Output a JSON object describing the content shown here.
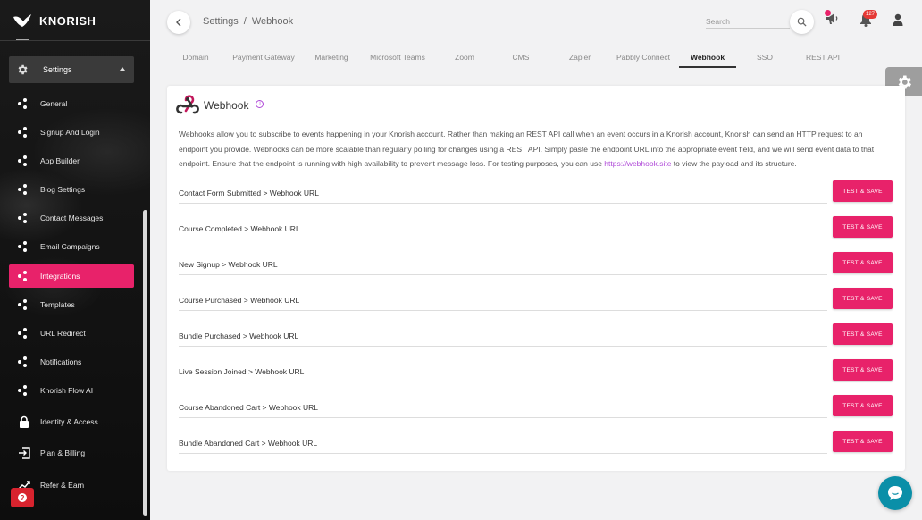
{
  "brand": {
    "name": "KNORISH"
  },
  "sidebar": {
    "group": {
      "label": "Settings"
    },
    "items": [
      {
        "label": "General",
        "icon": "dots-icon"
      },
      {
        "label": "Signup And Login",
        "icon": "dots-icon"
      },
      {
        "label": "App Builder",
        "icon": "dots-icon"
      },
      {
        "label": "Blog Settings",
        "icon": "dots-icon"
      },
      {
        "label": "Contact Messages",
        "icon": "dots-icon"
      },
      {
        "label": "Email Campaigns",
        "icon": "dots-icon"
      },
      {
        "label": "Integrations",
        "icon": "dots-icon",
        "active": true
      },
      {
        "label": "Templates",
        "icon": "dots-icon"
      },
      {
        "label": "URL Redirect",
        "icon": "dots-icon"
      },
      {
        "label": "Notifications",
        "icon": "dots-icon"
      },
      {
        "label": "Knorish Flow AI",
        "icon": "dots-icon"
      },
      {
        "label": "Identity & Access",
        "icon": "lock-icon"
      },
      {
        "label": "Plan & Billing",
        "icon": "login-icon"
      },
      {
        "label": "Refer & Earn",
        "icon": "trending-icon"
      }
    ]
  },
  "header": {
    "breadcrumb": [
      "Settings",
      "Webhook"
    ],
    "separator": "/",
    "search_placeholder": "Search",
    "notification_count": "127"
  },
  "tabs": [
    "Domain",
    "Payment Gateway",
    "Marketing",
    "Microsoft Teams",
    "Zoom",
    "CMS",
    "Zapier",
    "Pabbly Connect",
    "Webhook",
    "SSO",
    "REST API"
  ],
  "active_tab": "Webhook",
  "card": {
    "title": "Webhook",
    "info": "i",
    "desc_before": "Webhooks allow you to subscribe to events happening in your Knorish account. Rather than making an REST API call when an event occurs in a Knorish account, Knorish can send an HTTP request to an endpoint you provide. Webhooks can be more scalable than regularly polling for changes using a REST API. Simply paste the endpoint URL into the appropriate event field, and we will send event data to that endpoint. Ensure that the endpoint is running with high availability to prevent message loss. For testing purposes, you can use ",
    "desc_link": "https://webhook.site",
    "desc_after": " to view the payload and its structure.",
    "button_label": "TEST & SAVE",
    "rows": [
      "Contact Form Submitted > Webhook URL",
      "Course Completed > Webhook URL",
      "New Signup > Webhook URL",
      "Course Purchased > Webhook URL",
      "Bundle Purchased > Webhook URL",
      "Live Session Joined > Webhook URL",
      "Course Abandoned Cart > Webhook URL",
      "Bundle Abandoned Cart > Webhook URL"
    ]
  },
  "colors": {
    "accent": "#e8226a",
    "link": "#b04ad8",
    "chat": "#0a8fa8"
  }
}
